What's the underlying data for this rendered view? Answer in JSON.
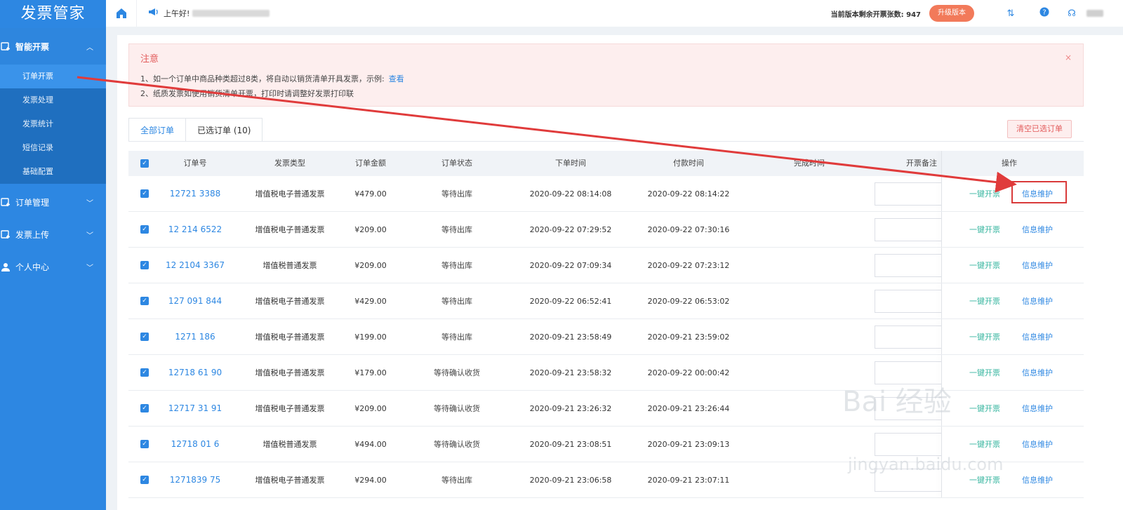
{
  "sidebar": {
    "brand": "发票管家",
    "groups": [
      {
        "label": "智能开票",
        "expanded": true,
        "items": [
          "订单开票",
          "发票处理",
          "发票统计",
          "短信记录",
          "基础配置"
        ],
        "active_item": "订单开票"
      },
      {
        "label": "订单管理",
        "expanded": false
      },
      {
        "label": "发票上传",
        "expanded": false
      },
      {
        "label": "个人中心",
        "expanded": false
      }
    ]
  },
  "header": {
    "greeting": "上午好!",
    "remaining_label": "当前版本剩余开票张数: 947",
    "upgrade_label": "升级版本"
  },
  "notice": {
    "title": "注意",
    "close": "×",
    "line1": "1、如一个订单中商品种类超过8类，将自动以销货清单开具发票，示例:",
    "line1_link": "查看",
    "line2": "2、纸质发票如使用销货清单开票，打印时请调整好发票打印联"
  },
  "tabs": [
    "全部订单",
    "已选订单 (10)"
  ],
  "clear_button": "清空已选订单",
  "table": {
    "headers": [
      "订单号",
      "发票类型",
      "订单金额",
      "订单状态",
      "下单时间",
      "付款时间",
      "完成时间",
      "开票备注",
      "操作"
    ],
    "rows": [
      {
        "order": "12721 3388",
        "type": "增值税电子普通发票",
        "amount": "¥479.00",
        "status": "等待出库",
        "ordered": "2020-09-22 08:14:08",
        "paid": "2020-09-22 08:14:22"
      },
      {
        "order": "12 214 6522",
        "type": "增值税电子普通发票",
        "amount": "¥209.00",
        "status": "等待出库",
        "ordered": "2020-09-22 07:29:52",
        "paid": "2020-09-22 07:30:16"
      },
      {
        "order": "12 2104 3367",
        "type": "增值税普通发票",
        "amount": "¥209.00",
        "status": "等待出库",
        "ordered": "2020-09-22 07:09:34",
        "paid": "2020-09-22 07:23:12"
      },
      {
        "order": "127 091 844",
        "type": "增值税电子普通发票",
        "amount": "¥429.00",
        "status": "等待出库",
        "ordered": "2020-09-22 06:52:41",
        "paid": "2020-09-22 06:53:02"
      },
      {
        "order": "1271 186",
        "type": "增值税电子普通发票",
        "amount": "¥199.00",
        "status": "等待出库",
        "ordered": "2020-09-21 23:58:49",
        "paid": "2020-09-21 23:59:02"
      },
      {
        "order": "12718 61 90",
        "type": "增值税电子普通发票",
        "amount": "¥179.00",
        "status": "等待确认收货",
        "ordered": "2020-09-21 23:58:32",
        "paid": "2020-09-22 00:00:42"
      },
      {
        "order": "12717 31 91",
        "type": "增值税电子普通发票",
        "amount": "¥209.00",
        "status": "等待确认收货",
        "ordered": "2020-09-21 23:26:32",
        "paid": "2020-09-21 23:26:44"
      },
      {
        "order": "12718 01 6",
        "type": "增值税普通发票",
        "amount": "¥494.00",
        "status": "等待确认收货",
        "ordered": "2020-09-21 23:08:51",
        "paid": "2020-09-21 23:09:13"
      },
      {
        "order": "1271839 75",
        "type": "增值税电子普通发票",
        "amount": "¥294.00",
        "status": "等待出库",
        "ordered": "2020-09-21 23:06:58",
        "paid": "2020-09-21 23:07:11"
      }
    ],
    "op1": "一键开票",
    "op2": "信息维护"
  },
  "watermark": {
    "main": "Bai 经验",
    "sub": "jingyan.baidu.com"
  },
  "colors": {
    "primary": "#2d87e2",
    "sidebar": "#2d87e2",
    "accent_teal": "#38b6a0",
    "danger": "#e35c5c",
    "upgrade": "#f27a5a"
  }
}
